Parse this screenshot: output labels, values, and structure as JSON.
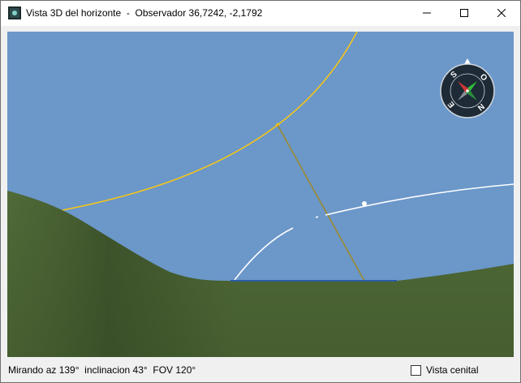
{
  "window": {
    "title": "Vista 3D del horizonte  -  Observador 36,7242, -2,1792",
    "min_label": "minimize",
    "max_label": "maximize",
    "close_label": "close"
  },
  "viewport": {
    "sky_color": "#6b97c9",
    "ground_color": "#4d6534",
    "sun_path_color": "#f5c518",
    "compass": {
      "labels": [
        "S",
        "O",
        "N",
        "E"
      ]
    }
  },
  "status": {
    "info": "Mirando az 139°  inclinacion 43°  FOV 120°",
    "cenital_label": "Vista cenital",
    "cenital_checked": false
  }
}
